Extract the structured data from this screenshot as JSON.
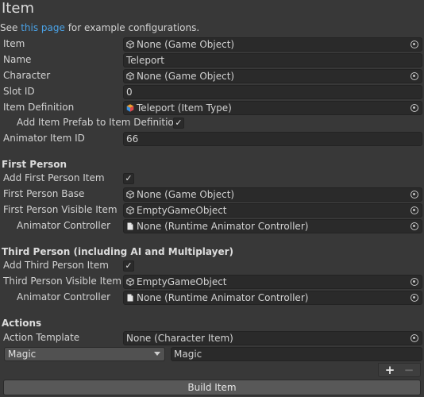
{
  "header": {
    "title": "Item",
    "subtitle_pre": "See ",
    "subtitle_link": "this page",
    "subtitle_post": " for example configurations."
  },
  "fields": {
    "item": {
      "label": "Item",
      "value": "None (Game Object)"
    },
    "name": {
      "label": "Name",
      "value": "Teleport"
    },
    "character": {
      "label": "Character",
      "value": "None (Game Object)"
    },
    "slot_id": {
      "label": "Slot ID",
      "value": "0"
    },
    "item_definition": {
      "label": "Item Definition",
      "value": "Teleport (Item Type)"
    },
    "add_prefab": {
      "label": "Add Item Prefab to Item Definition",
      "checked": "✓"
    },
    "animator_item_id": {
      "label": "Animator Item ID",
      "value": "66"
    }
  },
  "first_person": {
    "heading": "First Person",
    "add_item": {
      "label": "Add First Person Item",
      "checked": "✓"
    },
    "base": {
      "label": "First Person Base",
      "value": "None (Game Object)"
    },
    "visible_item": {
      "label": "First Person Visible Item",
      "value": "EmptyGameObject"
    },
    "animator_controller": {
      "label": "Animator Controller",
      "value": "None (Runtime Animator Controller)"
    }
  },
  "third_person": {
    "heading": "Third Person (including AI and Multiplayer)",
    "add_item": {
      "label": "Add Third Person Item",
      "checked": "✓"
    },
    "visible_item": {
      "label": "Third Person Visible Item",
      "value": "EmptyGameObject"
    },
    "animator_controller": {
      "label": "Animator Controller",
      "value": "None (Runtime Animator Controller)"
    }
  },
  "actions": {
    "heading": "Actions",
    "action_template": {
      "label": "Action Template",
      "value": "None (Character Item)"
    },
    "dropdown_value": "Magic",
    "name_value": "Magic",
    "plus": "+",
    "minus": "−"
  },
  "build_button": "Build Item",
  "colors": {
    "background": "#383838",
    "field_bg": "#2a2a2a",
    "link": "#4aa3e8",
    "button": "#585858"
  }
}
